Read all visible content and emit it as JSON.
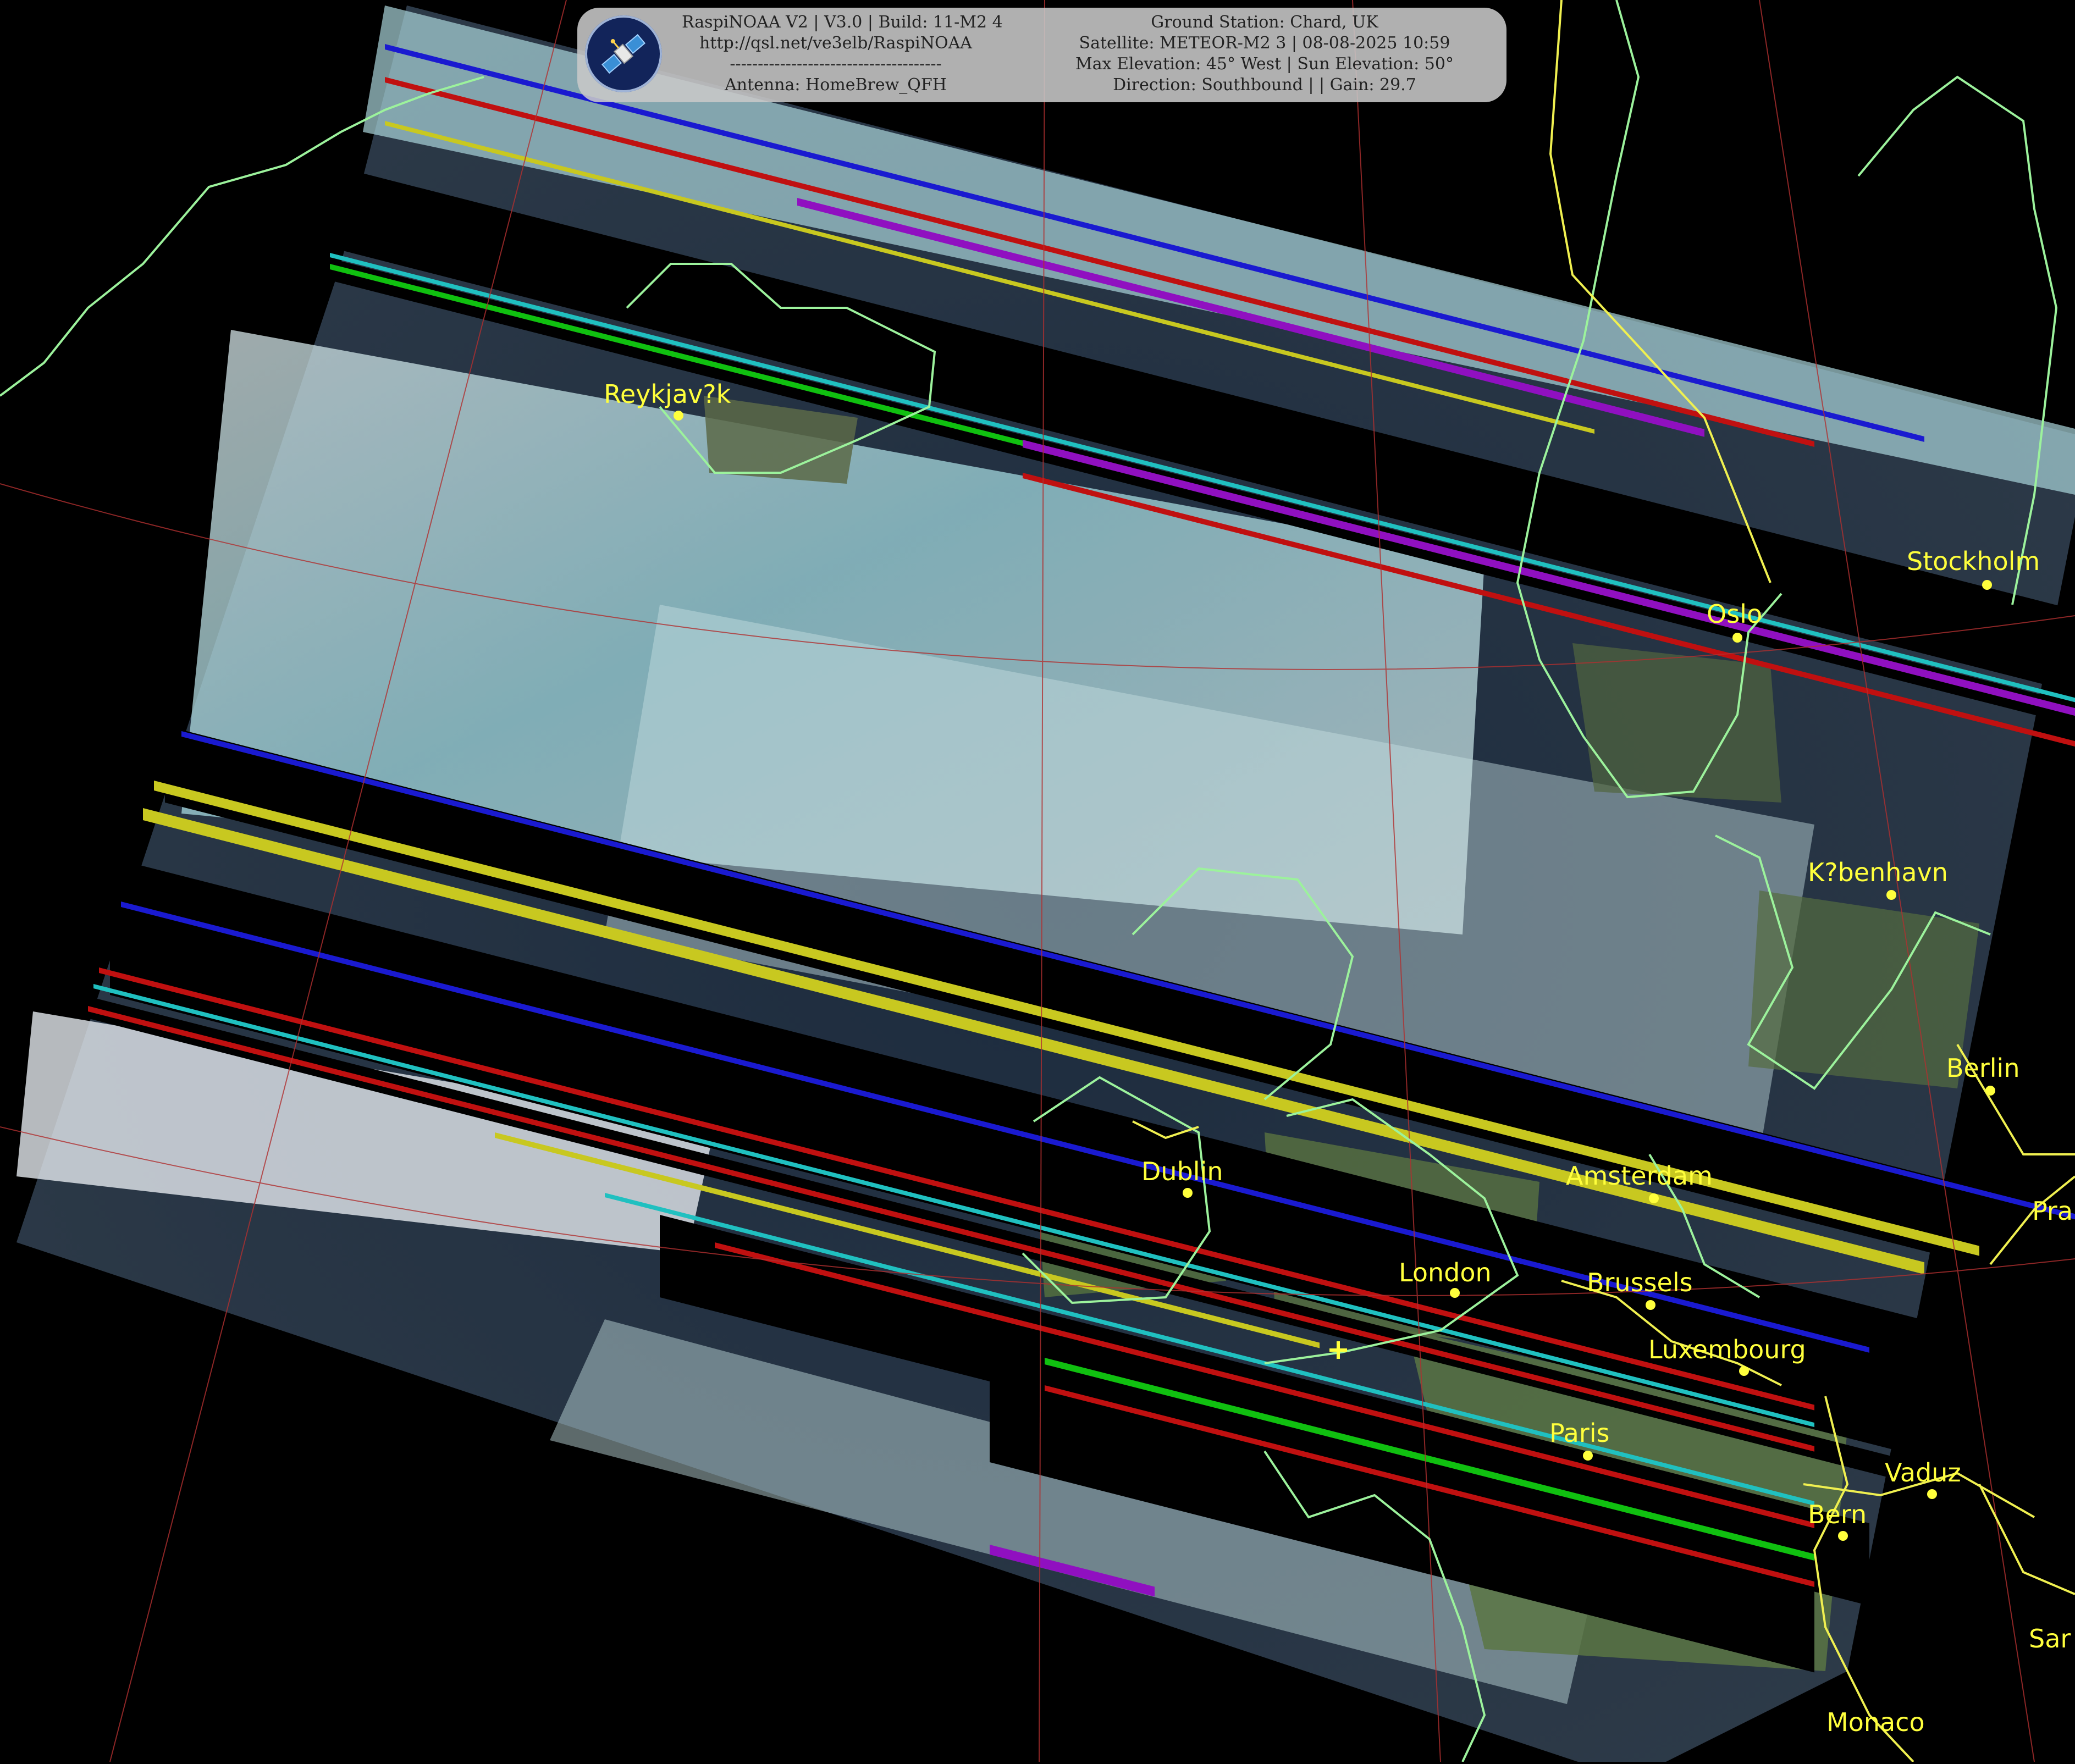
{
  "header": {
    "left_lines": [
      "RaspiNOAA V2 | V3.0 | Build: 11-M2 4",
      "http://qsl.net/ve3elb/RaspiNOAA",
      "--------------------------------------",
      "Antenna: HomeBrew_QFH"
    ],
    "right_lines": [
      "Ground Station: Chard, UK",
      "Satellite: METEOR-M2 3 | 08-08-2025 10:59",
      "Max Elevation: 45° West | Sun Elevation: 50°",
      "Direction: Southbound | | Gain: 29.7"
    ],
    "logo_icon": "satellite-icon"
  },
  "cities": [
    {
      "name": "Reykjav?k"
    },
    {
      "name": "Oslo"
    },
    {
      "name": "Stockholm"
    },
    {
      "name": "K?benhavn"
    },
    {
      "name": "Berlin"
    },
    {
      "name": "Dublin"
    },
    {
      "name": "Amsterdam"
    },
    {
      "name": "London"
    },
    {
      "name": "Brussels"
    },
    {
      "name": "Luxembourg"
    },
    {
      "name": "Paris"
    },
    {
      "name": "Vaduz"
    },
    {
      "name": "Bern"
    },
    {
      "name": "Monaco"
    },
    {
      "name": "Pra"
    },
    {
      "name": "Sar"
    }
  ],
  "colors": {
    "background": "#000000",
    "coastline": "#9cf29c",
    "border": "#f0f050",
    "graticule": "#b03030",
    "city_label": "#ffff3c",
    "ocean": "#1e2a3a",
    "cloud": "#cfe6ea",
    "land": "#4d6a3a"
  }
}
